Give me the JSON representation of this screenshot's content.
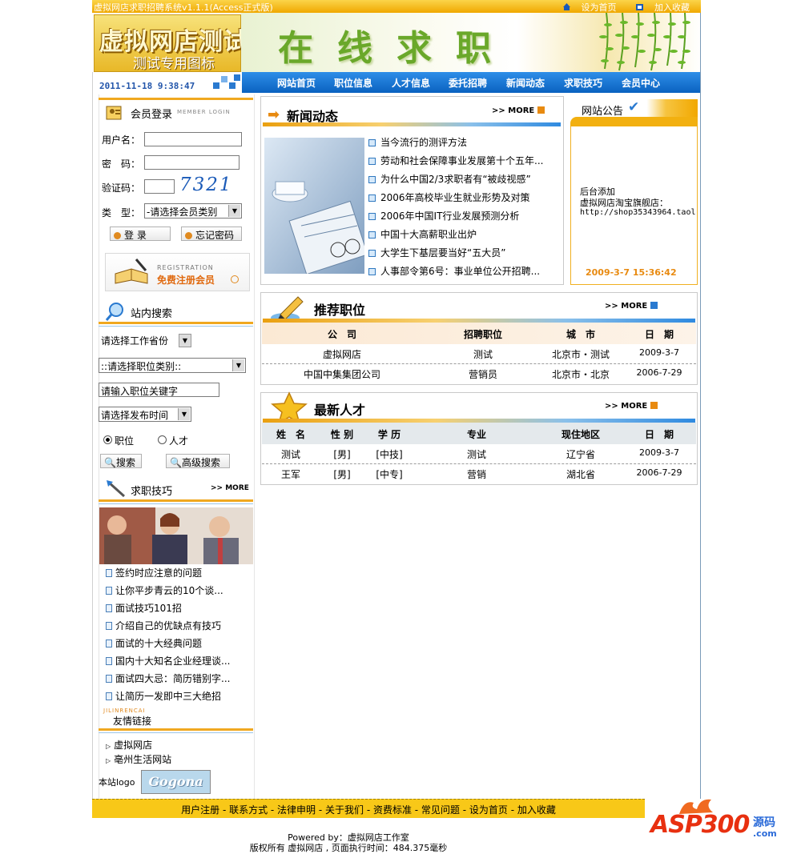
{
  "topbar": {
    "title": "虚拟网店求职招聘系统v1.1.1(Access正式版)",
    "set_home": "设为首页",
    "add_fav": "加入收藏"
  },
  "header": {
    "logo_line1": "虚拟网店测试",
    "logo_line2": "测试专用图标",
    "slogan": "在线求职",
    "datetime": "2011-11-18 9:38:47"
  },
  "nav": [
    "网站首页",
    "职位信息",
    "人才信息",
    "委托招聘",
    "新闻动态",
    "求职技巧",
    "会员中心"
  ],
  "login": {
    "title": "会员登录",
    "subtitle": "MEMBER LOGIN",
    "username_label": "用户名：",
    "password_label": "密　码：",
    "captcha_label": "验证码：",
    "captcha_value": "7321",
    "type_label": "类　型：",
    "type_select": "-请选择会员类别",
    "login_button": "登 录",
    "forgot_button": "忘记密码"
  },
  "register": {
    "tag": "REGISTRATION",
    "label": "免费注册会员"
  },
  "search": {
    "title": "站内搜索",
    "province_select": "请选择工作省份",
    "category_select": "::请选择职位类别::",
    "keyword_placeholder": "请输入职位关键字",
    "time_select": "请选择发布时间",
    "radio_job": "职位",
    "radio_talent": "人才",
    "search_button": "搜索",
    "advanced_button": "高级搜索"
  },
  "tips": {
    "title": "求职技巧",
    "more": ">> MORE",
    "items": [
      "签约时应注意的问题",
      "让你平步青云的10个谈...",
      "面试技巧101招",
      "介绍自己的优缺点有技巧",
      "面试的十大经典问题",
      "国内十大知名企业经理谈...",
      "面试四大忌：简历错别字...",
      "让简历一发即中三大绝招"
    ]
  },
  "links": {
    "tag": "JILINRENCAI",
    "title": "友情链接",
    "items": [
      "虚拟网店",
      "亳州生活网站"
    ],
    "logo_label": "本站logo",
    "logo_text": "Gogona"
  },
  "news": {
    "title": "新闻动态",
    "more": ">> MORE",
    "items": [
      "当今流行的测评方法",
      "劳动和社会保障事业发展第十个五年...",
      "为什么中国2/3求职者有“被歧视感”",
      "2006年高校毕业生就业形势及对策",
      "2006年中国IT行业发展预测分析",
      "中国十大高薪职业出炉",
      "大学生下基层要当好“五大员”",
      "人事部令第6号：事业单位公开招聘..."
    ]
  },
  "notice": {
    "title": "网站公告",
    "line1": "后台添加",
    "line2": "虚拟网店淘宝旗舰店：",
    "line3": "http://shop35343964.taol",
    "date": "2009-3-7 15:36:42"
  },
  "jobs": {
    "title": "推荐职位",
    "more": ">> MORE",
    "headers": [
      "公　司",
      "招聘职位",
      "城　市",
      "日　期"
    ],
    "rows": [
      [
        "虚拟网店",
        "测试",
        "北京市・测试",
        "2009-3-7"
      ],
      [
        "中国中集集团公司",
        "营销员",
        "北京市・北京",
        "2006-7-29"
      ]
    ]
  },
  "talents": {
    "title": "最新人才",
    "more": ">> MORE",
    "headers": [
      "姓　名",
      "性 别",
      "学 历",
      "专业",
      "现住地区",
      "日　期"
    ],
    "rows": [
      [
        "测试",
        "[男]",
        "[中技]",
        "测试",
        "辽宁省",
        "2009-3-7"
      ],
      [
        "王军",
        "[男]",
        "[中专]",
        "营销",
        "湖北省",
        "2006-7-29"
      ]
    ]
  },
  "footer": {
    "links": "用户注册 - 联系方式 - 法律申明 - 关于我们 - 资费标准 - 常见问题 - 设为首页 - 加入收藏",
    "powered": "Powered by：虚拟网店工作室",
    "copyright": "版权所有 虚拟网店 , 页面执行时间：484.375毫秒"
  },
  "watermark": {
    "brand": "ASP300",
    "cn": "源码",
    "com": ".com"
  },
  "colors": {
    "accent_orange": "#f0a820",
    "nav_blue": "#0a62c0",
    "date_orange": "#e88a10"
  }
}
